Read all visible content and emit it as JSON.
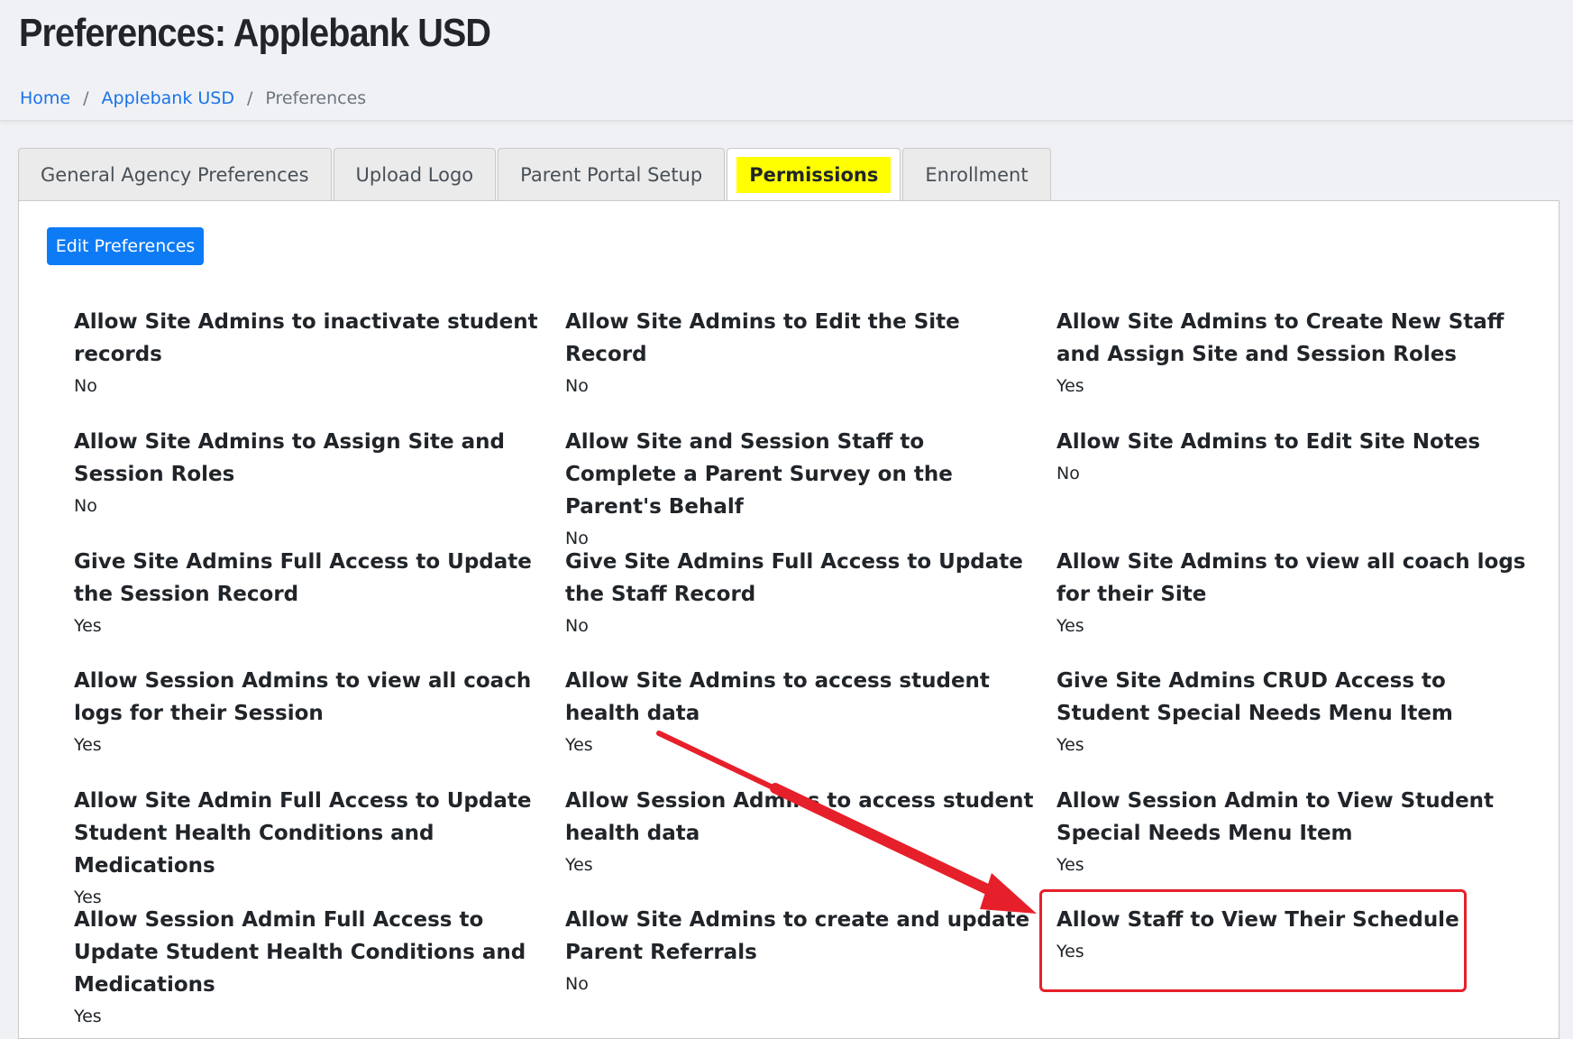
{
  "header": {
    "title": "Preferences: Applebank USD",
    "breadcrumb": {
      "home": "Home",
      "agency": "Applebank USD",
      "current": "Preferences",
      "separator": "/"
    }
  },
  "tabs": [
    {
      "label": "General Agency Preferences"
    },
    {
      "label": "Upload Logo"
    },
    {
      "label": "Parent Portal Setup"
    },
    {
      "label": "Permissions"
    },
    {
      "label": "Enrollment"
    }
  ],
  "panel": {
    "edit_button": "Edit Preferences",
    "preferences": [
      {
        "label": "Allow Site Admins to inactivate student records",
        "value": "No"
      },
      {
        "label": "Allow Site Admins to Edit the Site Record",
        "value": "No"
      },
      {
        "label": "Allow Site Admins to Create New Staff and Assign Site and Session Roles",
        "value": "Yes"
      },
      {
        "label": "Allow Site Admins to Assign Site and Session Roles",
        "value": "No"
      },
      {
        "label": "Allow Site and Session Staff to Complete a Parent Survey on the Parent's Behalf",
        "value": "No"
      },
      {
        "label": "Allow Site Admins to Edit Site Notes",
        "value": "No"
      },
      {
        "label": "Give Site Admins Full Access to Update the Session Record",
        "value": "Yes"
      },
      {
        "label": "Give Site Admins Full Access to Update the Staff Record",
        "value": "No"
      },
      {
        "label": "Allow Site Admins to view all coach logs for their Site",
        "value": "Yes"
      },
      {
        "label": "Allow Session Admins to view all coach logs for their Session",
        "value": "Yes"
      },
      {
        "label": "Allow Site Admins to access student health data",
        "value": "Yes"
      },
      {
        "label": "Give Site Admins CRUD Access to Student Special Needs Menu Item",
        "value": "Yes"
      },
      {
        "label": "Allow Site Admin Full Access to Update Student Health Conditions and Medications",
        "value": "Yes"
      },
      {
        "label": "Allow Session Admins to access student health data",
        "value": "Yes"
      },
      {
        "label": "Allow Session Admin to View Student Special Needs Menu Item",
        "value": "Yes"
      },
      {
        "label": "Allow Session Admin Full Access to Update Student Health Conditions and Medications",
        "value": "Yes"
      },
      {
        "label": "Allow Site Admins to create and update Parent Referrals",
        "value": "No"
      },
      {
        "label": "Allow Staff to View Their Schedule",
        "value": "Yes"
      }
    ]
  },
  "colors": {
    "link": "#1a73e8",
    "primary_button": "#0d7bf5",
    "active_tab_highlight": "#ffff00",
    "annotation_red": "#e6202a"
  },
  "icons": {
    "annotation_arrow": "red-arrow-icon"
  }
}
